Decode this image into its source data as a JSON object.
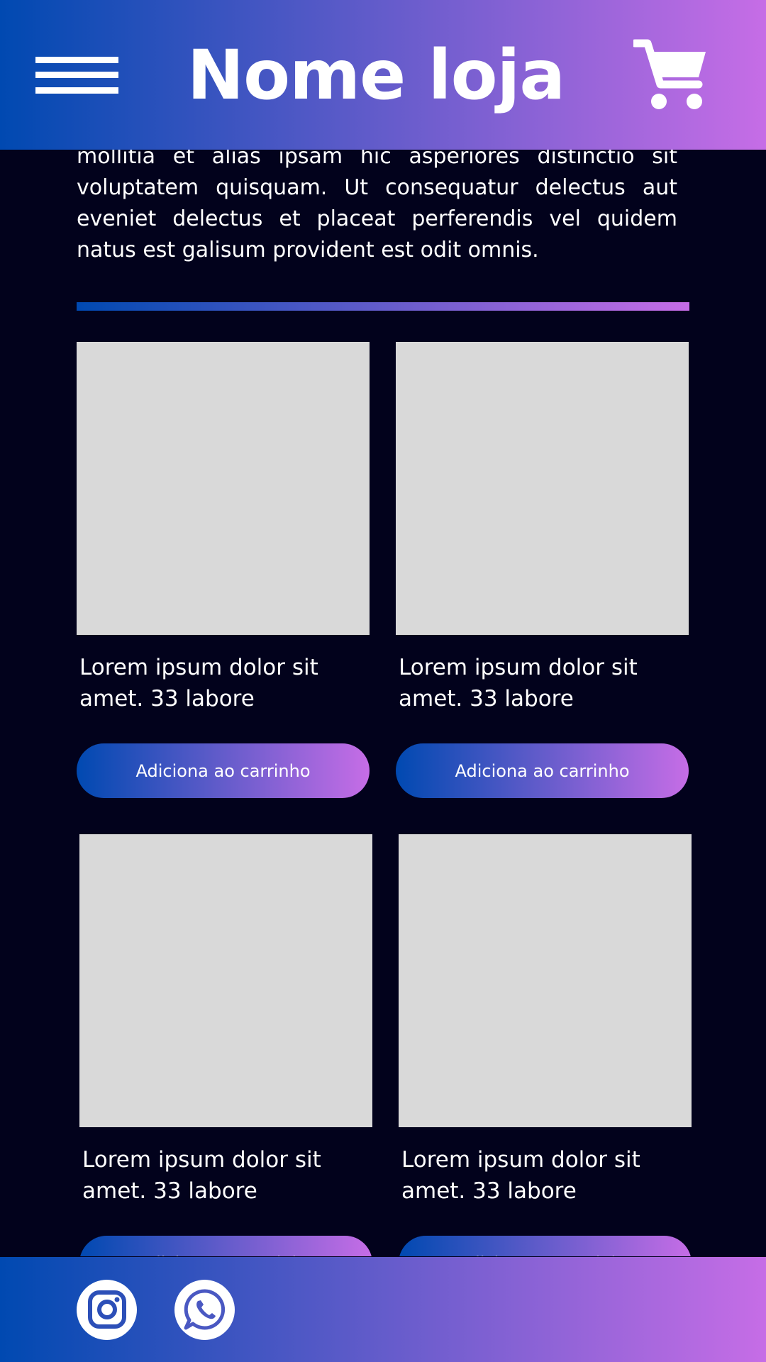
{
  "header": {
    "title": "Nome loja",
    "menu_icon": "hamburger-menu-icon",
    "cart_icon": "shopping-cart-icon"
  },
  "intro": {
    "text": "mollitia et alias ipsam hic asperiores distinctio sit voluptatem quisquam. Ut consequatur delectus aut eveniet delectus et placeat perferendis vel quidem natus est galisum provident est odit omnis."
  },
  "products": [
    {
      "name": "Lorem ipsum dolor sit amet. 33 labore",
      "button_label": "Adiciona ao carrinho"
    },
    {
      "name": "Lorem ipsum dolor sit amet. 33 labore",
      "button_label": "Adiciona ao carrinho"
    },
    {
      "name": "Lorem ipsum dolor sit amet. 33 labore",
      "button_label": "Adiciona ao carrinho"
    },
    {
      "name": "Lorem ipsum dolor sit amet. 33 labore",
      "button_label": "Adiciona ao carrinho"
    }
  ],
  "footer": {
    "icons": [
      "instagram-icon",
      "whatsapp-icon"
    ]
  },
  "colors": {
    "background": "#02021c",
    "gradient_start": "#0049b1",
    "gradient_end": "#c66de6",
    "image_placeholder": "#d9d9d9",
    "text": "#ffffff"
  }
}
